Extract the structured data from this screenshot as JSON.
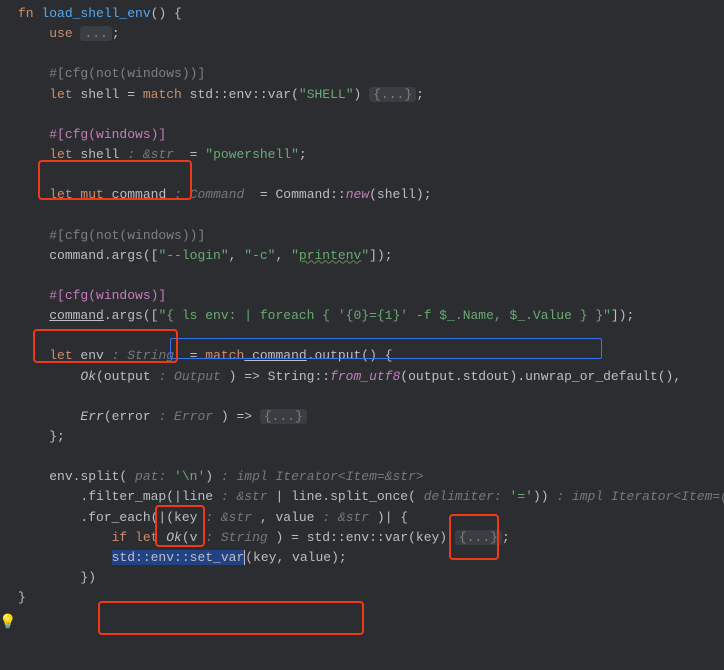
{
  "fn": {
    "keyword": "fn",
    "name": "load_shell_env",
    "parens": "()",
    "brace": " {"
  },
  "use_line": {
    "use": "use ",
    "fold": "...",
    "semi": ";"
  },
  "attr_notwin1": "#[cfg(not(windows))]",
  "shell1_let": "let",
  "shell1_name": " shell ",
  "shell1_eq": "= ",
  "shell1_match": "match",
  "shell1_call": " std::env::var(",
  "shell1_str": "\"SHELL\"",
  "shell1_close": ") ",
  "shell1_fold": "{...}",
  "shell1_semi": ";",
  "attr_win1": "#[cfg(windows)]",
  "shell2_let": "let",
  "shell2_name": " shell",
  "shell2_hint": " : &str ",
  "shell2_eq": " = ",
  "shell2_val": "\"powershell\"",
  "shell2_semi": ";",
  "cmd_let": "let",
  "cmd_mut": " mut",
  "cmd_name": " command",
  "cmd_hint": " : Command ",
  "cmd_eq": " = Command::",
  "cmd_new": "new",
  "cmd_tail": "(shell);",
  "attr_notwin2": "#[cfg(not(windows))]",
  "args1_a": "command.args([",
  "args1_s1": "\"--login\"",
  "args1_c1": ", ",
  "args1_s2": "\"-c\"",
  "args1_c2": ", ",
  "args1_s3": "\"",
  "args1_print": "printenv",
  "args1_s3b": "\"",
  "args1_tail": "]);",
  "attr_win2": "#[cfg(windows)]",
  "args2_a": "command",
  "args2_b": ".args([",
  "args2_s1": "\"{",
  "args2_ps": " ls env: | foreach { '{0}={1}' -f $_.Name, $_.Value }",
  "args2_s2": " }\"",
  "args2_tail": "]);",
  "env_let": "let",
  "env_name": " env",
  "env_hint": " : String ",
  "env_eq": " = ",
  "env_match": "match",
  "env_call": " command",
  "env_out": ".output() {",
  "ok_arm": "Ok",
  "ok_paren": "(output",
  "ok_hint": " : Output ",
  "ok_arrow": ") => String::",
  "ok_from": "from_utf8",
  "ok_tail": "(output.stdout).unwrap_or_default(),",
  "err_arm": "Err",
  "err_paren": "(error",
  "err_hint": " : Error ",
  "err_arrow": ") => ",
  "err_fold": "{...}",
  "close_match": "};",
  "split_a": "env.split(",
  "split_hint": " pat: ",
  "split_pat": "'\\n'",
  "split_close": ")",
  "split_rethint": " : impl Iterator<Item=&str>",
  "filter_a": ".filter_map(|line",
  "filter_h1": " : &str ",
  "filter_b": "| line.split_once(",
  "filter_h2": " delimiter: ",
  "filter_str": "'='",
  "filter_c": "))",
  "filter_rethint": " : impl Iterator<Item=(...)>",
  "foreach_a": ".for_each(|(key",
  "foreach_h1": " : &str ",
  "foreach_b": ", value",
  "foreach_h2": " : &str ",
  "foreach_c": ")| {",
  "iflet_a": "if",
  "iflet_b": " let",
  "iflet_c": " Ok",
  "iflet_d": "(v",
  "iflet_h": " : String ",
  "iflet_e": ") = std::env::var(key) ",
  "iflet_fold": "{...}",
  "iflet_semi": ";",
  "setvar_sel": "std::env::set_var",
  "setvar_tail": "(key, value)",
  "setvar_semi": ";",
  "close_fe": "})",
  "close_brace": "}",
  "bulb": "💡"
}
